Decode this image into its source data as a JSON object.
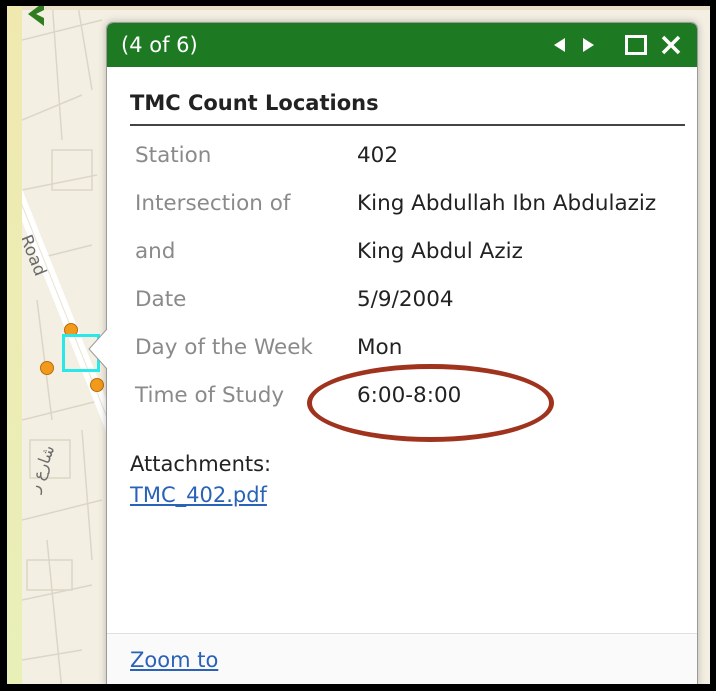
{
  "map": {
    "road_label": "Road",
    "arabic_label": "شارع ر"
  },
  "popup": {
    "feature_count": "(4 of 6)",
    "layer_title": "TMC Count Locations",
    "attributes": [
      {
        "key": "Station",
        "value": "402"
      },
      {
        "key": "Intersection of",
        "value": "King Abdullah Ibn Abdulaziz"
      },
      {
        "key": "and",
        "value": "King Abdul Aziz"
      },
      {
        "key": "Date",
        "value": "5/9/2004"
      },
      {
        "key": "Day of the Week",
        "value": "Mon"
      },
      {
        "key": "Time of Study",
        "value": "6:00-8:00"
      }
    ],
    "attachments_label": "Attachments:",
    "attachment_file": "TMC_402.pdf",
    "zoom_link": "Zoom to"
  },
  "colors": {
    "titlebar": "#1e7a22",
    "highlight_ellipse": "#a0331e",
    "selection": "#2be8e8",
    "poi": "#f39a1a",
    "link": "#2a62b8"
  },
  "icons": [
    "previous-icon",
    "next-icon",
    "maximize-icon",
    "close-icon",
    "feature-marker-icon"
  ]
}
